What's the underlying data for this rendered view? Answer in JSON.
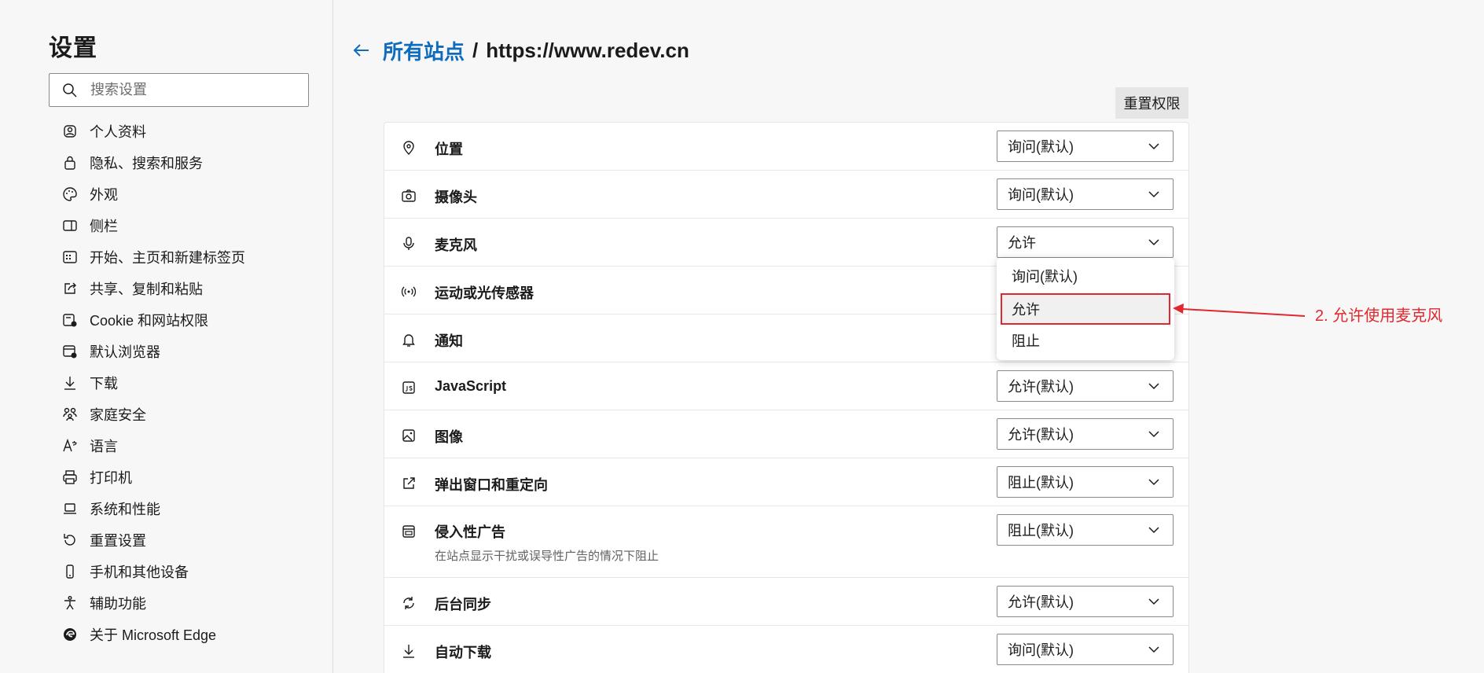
{
  "sidebar": {
    "title": "设置",
    "search_placeholder": "搜索设置",
    "items": [
      {
        "label": "个人资料",
        "icon": "profile-icon"
      },
      {
        "label": "隐私、搜索和服务",
        "icon": "lock-icon"
      },
      {
        "label": "外观",
        "icon": "palette-icon"
      },
      {
        "label": "侧栏",
        "icon": "sidebar-icon"
      },
      {
        "label": "开始、主页和新建标签页",
        "icon": "home-grid-icon"
      },
      {
        "label": "共享、复制和粘贴",
        "icon": "share-icon"
      },
      {
        "label": "Cookie 和网站权限",
        "icon": "site-permissions-icon"
      },
      {
        "label": "默认浏览器",
        "icon": "default-browser-icon"
      },
      {
        "label": "下载",
        "icon": "download-icon"
      },
      {
        "label": "家庭安全",
        "icon": "family-icon"
      },
      {
        "label": "语言",
        "icon": "language-icon"
      },
      {
        "label": "打印机",
        "icon": "printer-icon"
      },
      {
        "label": "系统和性能",
        "icon": "laptop-icon"
      },
      {
        "label": "重置设置",
        "icon": "reset-icon"
      },
      {
        "label": "手机和其他设备",
        "icon": "phone-icon"
      },
      {
        "label": "辅助功能",
        "icon": "accessibility-icon"
      },
      {
        "label": "关于 Microsoft Edge",
        "icon": "edge-logo-icon"
      }
    ]
  },
  "header": {
    "breadcrumb_link": "所有站点",
    "separator": "/",
    "site": "https://www.redev.cn"
  },
  "reset_button": "重置权限",
  "permissions": [
    {
      "label": "位置",
      "value": "询问(默认)",
      "icon": "location-icon"
    },
    {
      "label": "摄像头",
      "value": "询问(默认)",
      "icon": "camera-icon"
    },
    {
      "label": "麦克风",
      "value": "允许",
      "icon": "microphone-icon"
    },
    {
      "label": "运动或光传感器",
      "value": "",
      "icon": "sensor-icon"
    },
    {
      "label": "通知",
      "value": "",
      "icon": "bell-icon"
    },
    {
      "label": "JavaScript",
      "value": "允许(默认)",
      "icon": "javascript-icon"
    },
    {
      "label": "图像",
      "value": "允许(默认)",
      "icon": "image-icon"
    },
    {
      "label": "弹出窗口和重定向",
      "value": "阻止(默认)",
      "icon": "popup-icon"
    },
    {
      "label": "侵入性广告",
      "sublabel": "在站点显示干扰或误导性广告的情况下阻止",
      "value": "阻止(默认)",
      "icon": "ads-icon"
    },
    {
      "label": "后台同步",
      "value": "允许(默认)",
      "icon": "sync-icon"
    },
    {
      "label": "自动下载",
      "value": "询问(默认)",
      "icon": "download-icon"
    }
  ],
  "dropdown": {
    "options": [
      "询问(默认)",
      "允许",
      "阻止"
    ],
    "selected": "允许"
  },
  "annotation": {
    "text": "2. 允许使用麦克风",
    "color": "#e0282e"
  }
}
